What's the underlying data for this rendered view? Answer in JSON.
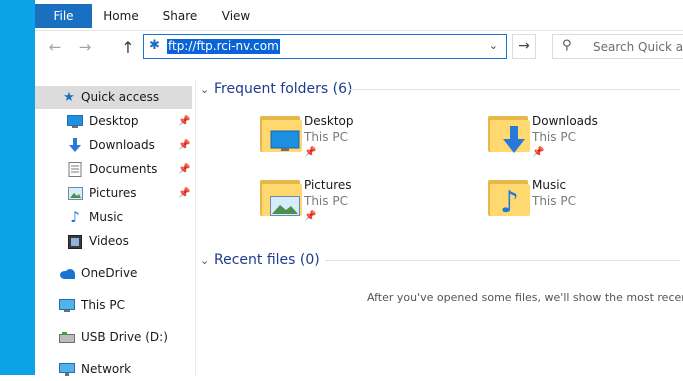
{
  "ribbon": {
    "tabs": [
      "File",
      "Home",
      "Share",
      "View"
    ]
  },
  "navigation": {
    "address": "ftp://ftp.rci-nv.com",
    "search_placeholder": "Search Quick acce"
  },
  "sidebar": {
    "quick_access": "Quick access",
    "pinned": [
      "Desktop",
      "Downloads",
      "Documents",
      "Pictures"
    ],
    "unpinned": [
      "Music",
      "Videos"
    ],
    "onedrive": "OneDrive",
    "this_pc": "This PC",
    "usb": "USB Drive (D:)",
    "network": "Network"
  },
  "frequent_folders": {
    "header": "Frequent folders (6)",
    "items": [
      {
        "name": "Desktop",
        "location": "This PC",
        "icon": "desktop-icon"
      },
      {
        "name": "Downloads",
        "location": "This PC",
        "icon": "download-arrow-icon"
      },
      {
        "name": "Pictures",
        "location": "This PC",
        "icon": "picture-icon"
      },
      {
        "name": "Music",
        "location": "This PC",
        "icon": "music-note-icon"
      }
    ]
  },
  "recent_files": {
    "header": "Recent files (0)",
    "empty_message": "After you've opened some files, we'll show the most recent o"
  },
  "colors": {
    "accent": "#1a6fc1",
    "desktop_background": "#0aa3e6",
    "selection": "#dcdcdc",
    "group_header": "#1e3c8c",
    "folder": "#ffd970"
  }
}
